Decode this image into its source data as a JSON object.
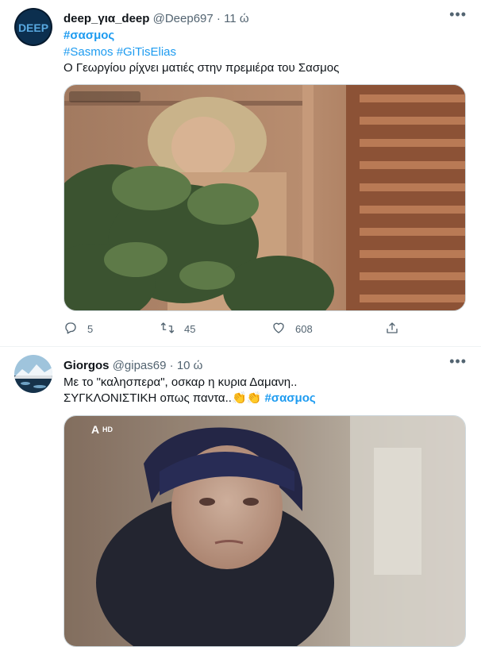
{
  "tweets": [
    {
      "user_name": "deep_για_deep",
      "handle": "@Deep697",
      "separator": " · ",
      "time": "11 ώ",
      "hashtag_bold": "#σασμος",
      "hashtags": [
        "#Sasmos",
        "#GiTisElias"
      ],
      "text": "Ο Γεωργίου ρίχνει ματιές στην πρεμιέρα του Σασμος",
      "avatar_text": "DEEP",
      "actions": {
        "replies": "5",
        "retweets": "45",
        "likes": "608"
      }
    },
    {
      "user_name": "Giorgos",
      "handle": "@gipas69",
      "separator": " · ",
      "time": "10 ώ",
      "text_line1": "Με το \"καλησπερα\", οσκαρ η κυρια Δαμανη..",
      "text_line2": "ΣΥΓΚΛΟΝΙΣΤΙΚΗ οπως παντα..",
      "emoji": "👏👏",
      "hashtag_bold": "#σασμος",
      "watermark": "HD"
    }
  ],
  "icons": {
    "more": "more-horizontal-icon",
    "reply": "reply-icon",
    "retweet": "retweet-icon",
    "like": "heart-icon",
    "share": "share-icon"
  },
  "colors": {
    "link": "#1d9bf0",
    "muted": "#536471",
    "border": "#eff3f4"
  }
}
